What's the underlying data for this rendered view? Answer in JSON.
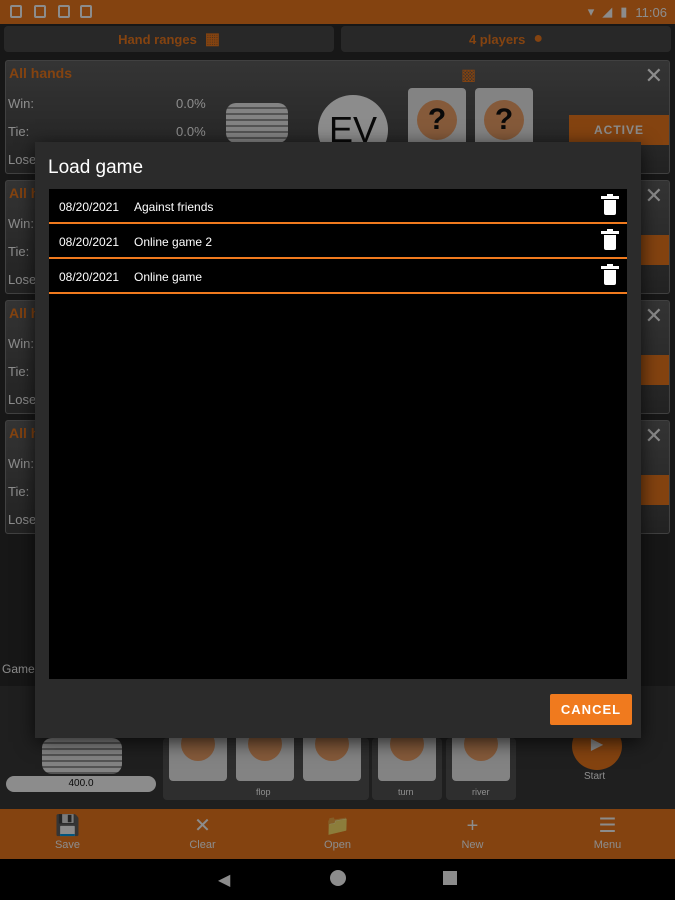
{
  "status_bar": {
    "time": "11:06"
  },
  "top_bar": {
    "hand_ranges_label": "Hand ranges",
    "players_label": "4 players"
  },
  "panels": [
    {
      "title": "All hands",
      "win_label": "Win:",
      "tie_label": "Tie:",
      "lose_label": "Lose",
      "win_value": "0.0%",
      "tie_value": "0.0%",
      "active_label": "ACTIVE",
      "ev_label": "EV"
    },
    {
      "title": "All h",
      "win_label": "Win:",
      "tie_label": "Tie:",
      "lose_label": "Lose"
    },
    {
      "title": "All h",
      "win_label": "Win:",
      "tie_label": "Tie:",
      "lose_label": "Lose"
    },
    {
      "title": "All h",
      "win_label": "Win:",
      "tie_label": "Tie:",
      "lose_label": "Lose"
    }
  ],
  "board": {
    "game_label": "Game",
    "stack_value": "400.0",
    "flop_label": "flop",
    "turn_label": "turn",
    "river_label": "river",
    "start_label": "Start"
  },
  "dialog": {
    "title": "Load game",
    "cancel_label": "CANCEL",
    "games": [
      {
        "date": "08/20/2021",
        "name": "Against friends"
      },
      {
        "date": "08/20/2021",
        "name": "Online game 2"
      },
      {
        "date": "08/20/2021",
        "name": "Online game"
      }
    ]
  },
  "bottom_nav": {
    "save": "Save",
    "clear": "Clear",
    "open": "Open",
    "new": "New",
    "menu": "Menu"
  },
  "colors": {
    "accent": "#f07a1e",
    "background": "#2b2b2b",
    "list_bg": "#000000"
  }
}
